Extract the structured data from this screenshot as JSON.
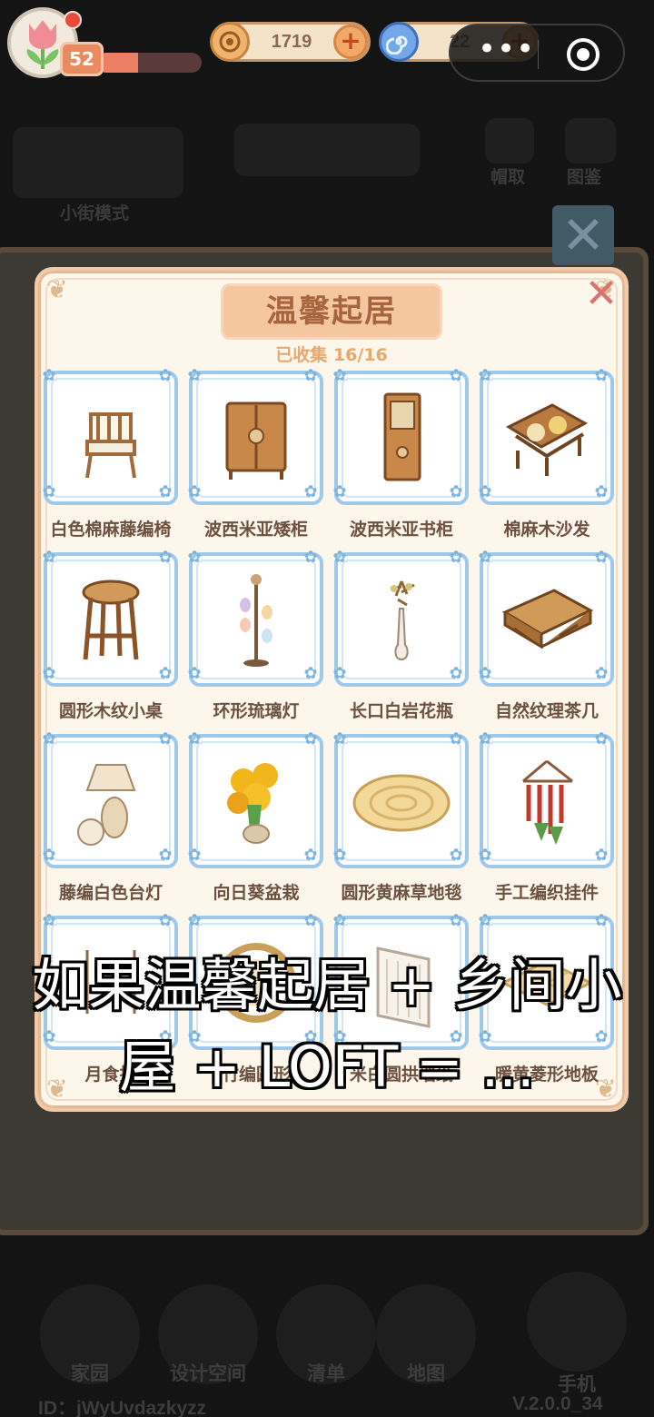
{
  "hud": {
    "level": "52",
    "xp_fraction": 0.4,
    "coins": "1719",
    "gems": "22",
    "capsule_dots": "•••"
  },
  "background": {
    "left_label": "小街模式",
    "icon_labels": [
      "帽取",
      "图鉴"
    ]
  },
  "album": {
    "title": "温馨起居",
    "collected": "已收集 16/16",
    "items": [
      {
        "name": "白色棉麻藤编椅",
        "icon": "rattan-chair-icon"
      },
      {
        "name": "波西米亚矮柜",
        "icon": "low-cabinet-icon"
      },
      {
        "name": "波西米亚书柜",
        "icon": "bookcase-icon"
      },
      {
        "name": "棉麻木沙发",
        "icon": "wood-sofa-icon"
      },
      {
        "name": "圆形木纹小桌",
        "icon": "wooden-stool-icon"
      },
      {
        "name": "环形琉璃灯",
        "icon": "glass-lamp-icon"
      },
      {
        "name": "长口白岩花瓶",
        "icon": "vase-icon"
      },
      {
        "name": "自然纹理茶几",
        "icon": "coffee-table-icon"
      },
      {
        "name": "藤编白色台灯",
        "icon": "table-lamp-icon"
      },
      {
        "name": "向日葵盆栽",
        "icon": "sunflower-pot-icon"
      },
      {
        "name": "圆形黄麻草地毯",
        "icon": "jute-rug-icon"
      },
      {
        "name": "手工编织挂件",
        "icon": "macrame-hanging-icon"
      },
      {
        "name": "月食挂",
        "icon": "eclipse-hanging-icon"
      },
      {
        "name": "竹编圆形",
        "icon": "bamboo-round-icon"
      },
      {
        "name": "米白圆拱墙纸",
        "icon": "arch-wallpaper-icon"
      },
      {
        "name": "暖黄菱形地板",
        "icon": "diamond-floor-icon"
      }
    ]
  },
  "overlay": {
    "line1": "如果温馨起居 + 乡间小",
    "line2": "屋 + LOFT = ..."
  },
  "nav": {
    "items": [
      "家园",
      "设计空间",
      "清单",
      "地图",
      "手机"
    ]
  },
  "footer": {
    "id": "ID：jWyUvdazkyzz",
    "version": "V.2.0.0_34"
  },
  "colors": {
    "panel_bg": "#fdf6ea",
    "card_border": "#9ec9ea",
    "title_plate": "#f4c7a1",
    "label_text": "#6d5140",
    "close_x": "#d7746f"
  }
}
